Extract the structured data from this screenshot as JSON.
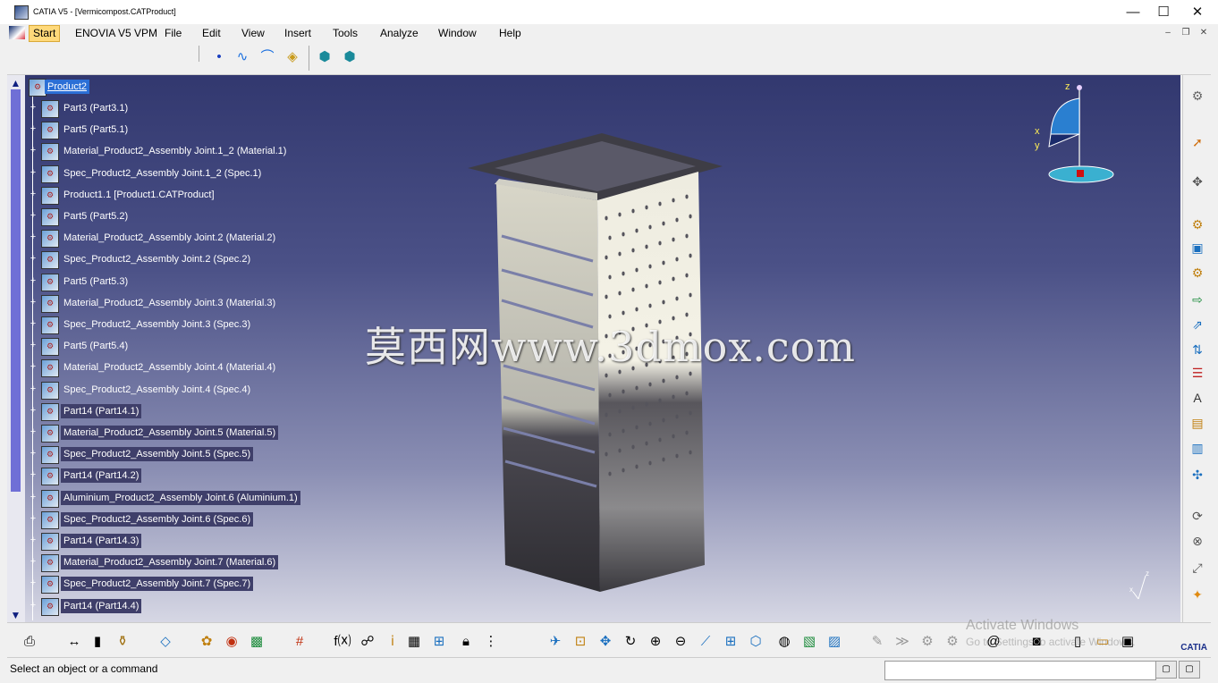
{
  "window": {
    "title": "CATIA V5 - [Vermicompost.CATProduct]",
    "minimize": "—",
    "maximize": "☐",
    "close": "✕"
  },
  "menu": {
    "items": [
      "Start",
      "ENOVIA V5 VPM",
      "File",
      "Edit",
      "View",
      "Insert",
      "Tools",
      "Analyze",
      "Window",
      "Help"
    ],
    "mdi_min": "–",
    "mdi_restore": "❐",
    "mdi_close": "✕"
  },
  "tree": {
    "root": "Product2",
    "nodes": [
      {
        "label": "Part3 (Part3.1)",
        "selected": false
      },
      {
        "label": "Part5 (Part5.1)",
        "selected": false
      },
      {
        "label": "Material_Product2_Assembly Joint.1_2 (Material.1)",
        "selected": false
      },
      {
        "label": "Spec_Product2_Assembly Joint.1_2 (Spec.1)",
        "selected": false
      },
      {
        "label": "Product1.1 [Product1.CATProduct]",
        "selected": false
      },
      {
        "label": "Part5 (Part5.2)",
        "selected": false
      },
      {
        "label": "Material_Product2_Assembly Joint.2 (Material.2)",
        "selected": false
      },
      {
        "label": "Spec_Product2_Assembly Joint.2 (Spec.2)",
        "selected": false
      },
      {
        "label": "Part5 (Part5.3)",
        "selected": false
      },
      {
        "label": "Material_Product2_Assembly Joint.3 (Material.3)",
        "selected": false
      },
      {
        "label": "Spec_Product2_Assembly Joint.3 (Spec.3)",
        "selected": false
      },
      {
        "label": "Part5 (Part5.4)",
        "selected": false
      },
      {
        "label": "Material_Product2_Assembly Joint.4 (Material.4)",
        "selected": false
      },
      {
        "label": "Spec_Product2_Assembly Joint.4 (Spec.4)",
        "selected": false
      },
      {
        "label": "Part14 (Part14.1)",
        "selected": true
      },
      {
        "label": "Material_Product2_Assembly Joint.5 (Material.5)",
        "selected": true
      },
      {
        "label": "Spec_Product2_Assembly Joint.5 (Spec.5)",
        "selected": true
      },
      {
        "label": "Part14 (Part14.2)",
        "selected": true
      },
      {
        "label": "Aluminium_Product2_Assembly Joint.6 (Aluminium.1)",
        "selected": true
      },
      {
        "label": "Spec_Product2_Assembly Joint.6 (Spec.6)",
        "selected": true
      },
      {
        "label": "Part14 (Part14.3)",
        "selected": true
      },
      {
        "label": "Material_Product2_Assembly Joint.7 (Material.6)",
        "selected": true
      },
      {
        "label": "Spec_Product2_Assembly Joint.7 (Spec.7)",
        "selected": true
      },
      {
        "label": "Part14 (Part14.4)",
        "selected": true
      }
    ]
  },
  "viewport": {
    "watermark": "莫西网www.3dmox.com",
    "compass_z": "z",
    "compass_x": "x",
    "compass_y": "y",
    "mini_axis_z": "z",
    "mini_axis_x": "x"
  },
  "bottom": {
    "activate_line1": "Activate Windows",
    "activate_line2": "Go to Settings to activate Windows.",
    "catia_logo": "CATIA"
  },
  "status": {
    "text": "Select an object or a command",
    "command_value": ""
  },
  "colors": {
    "viewport_top": "#32386f",
    "viewport_bottom": "#d6d7e4",
    "selection": "#3f3f6a",
    "root_highlight": "#2b6fd6"
  }
}
